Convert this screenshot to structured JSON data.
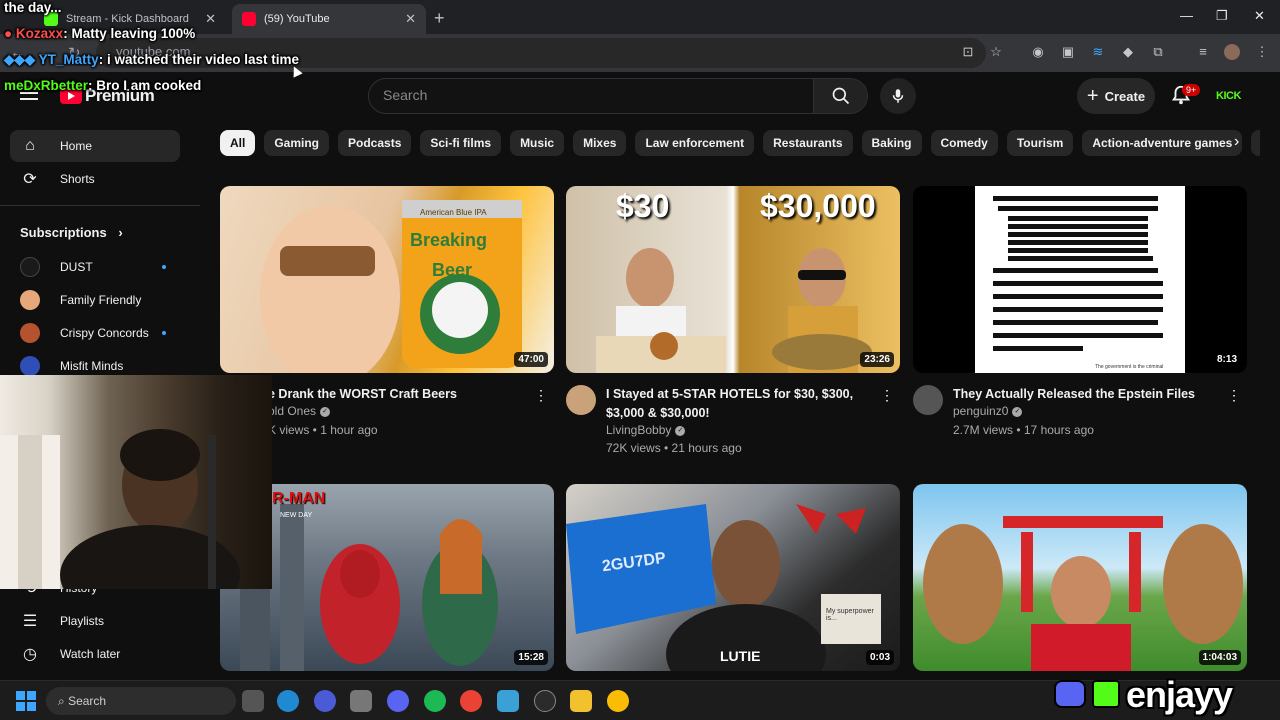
{
  "browser": {
    "tabs": [
      {
        "label": "Stream - Kick Dashboard",
        "favicon_color": "#53fc18"
      },
      {
        "label": "(59) YouTube",
        "favicon_color": "#ff0033"
      }
    ],
    "new_tab": "+",
    "url": "youtube.com"
  },
  "masthead": {
    "logo_text": "Premium",
    "search_placeholder": "Search",
    "create_label": "Create",
    "notification_count": "9+",
    "kick_label": "KICK"
  },
  "sidebar": {
    "main": [
      {
        "label": "Home",
        "icon": "home-icon"
      },
      {
        "label": "Shorts",
        "icon": "shorts-icon"
      }
    ],
    "subscriptions_header": "Subscriptions",
    "subscriptions": [
      {
        "name": "DUST",
        "color": "#1a1a1a",
        "new": true
      },
      {
        "name": "Family Friendly",
        "color": "#e6a77a",
        "new": false
      },
      {
        "name": "Crispy Concords",
        "color": "#b5532e",
        "new": true
      },
      {
        "name": "Misfit Minds",
        "color": "#2f4fb7",
        "new": false
      }
    ],
    "you": [
      {
        "label": "History",
        "icon": "history-icon"
      },
      {
        "label": "Playlists",
        "icon": "playlists-icon"
      },
      {
        "label": "Watch later",
        "icon": "clock-icon"
      }
    ]
  },
  "chips": [
    "All",
    "Gaming",
    "Podcasts",
    "Sci-fi films",
    "Music",
    "Mixes",
    "Law enforcement",
    "Restaurants",
    "Baking",
    "Comedy",
    "Tourism",
    "Action-adventure games",
    "Ca"
  ],
  "videos": [
    {
      "title": "e Drank the WORST Craft Beers",
      "channel": "old Ones",
      "stats": "K views • 1 hour ago",
      "duration": "47:00",
      "avatar_color": "#7a5a3a",
      "thumb_text_1": "American Blue IPA",
      "thumb_text_2": "Breaking",
      "thumb_text_3": "Beer"
    },
    {
      "title": "I Stayed at 5-STAR HOTELS for $30, $300, $3,000 & $30,000!",
      "channel": "LivingBobby",
      "stats": "72K views • 21 hours ago",
      "duration": "23:26",
      "avatar_color": "#caa27a",
      "thumb_text_1": "$30",
      "thumb_text_2": "$30,000"
    },
    {
      "title": "They Actually Released the Epstein Files",
      "channel": "penguinz0",
      "stats": "2.7M views • 17 hours ago",
      "duration": "8:13",
      "avatar_color": "#555",
      "thumb_text_1": "The government is the criminal"
    },
    {
      "title": "",
      "channel": "",
      "stats": "",
      "duration": "15:28",
      "thumb_text_1": "R-MAN",
      "thumb_text_2": "NEW DAY"
    },
    {
      "title": "",
      "channel": "",
      "stats": "",
      "duration": "0:03",
      "thumb_text_1": "2GU7DP",
      "thumb_text_2": "LUTIE",
      "thumb_text_3": "My superpower is..."
    },
    {
      "title": "",
      "channel": "",
      "stats": "",
      "duration": "1:04:03"
    }
  ],
  "chat_overlay": {
    "header": "the day...",
    "messages": [
      {
        "user": "Kozaxx",
        "text": "Matty leaving 100%",
        "user_color": "#ff4d4d"
      },
      {
        "user": "YT_Matty",
        "text": "i watched their video last time",
        "user_color": "#3ea6ff"
      },
      {
        "user": "meDxRbetter",
        "text": "Bro I am cooked",
        "user_color": "#53fc18"
      }
    ]
  },
  "taskbar": {
    "search_label": "Search"
  },
  "brand": {
    "name": "enjayy"
  }
}
